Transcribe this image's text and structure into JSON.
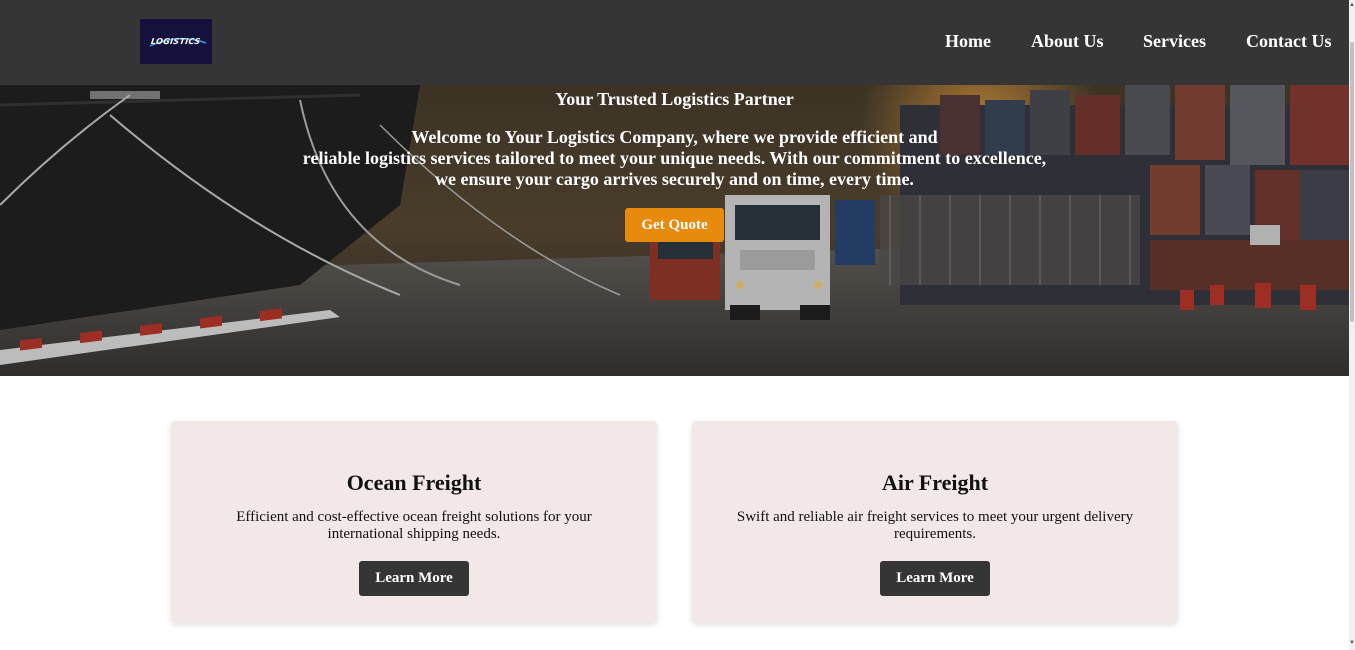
{
  "header": {
    "logo_text": "LOGISTICS",
    "nav": [
      {
        "label": "Home"
      },
      {
        "label": "About Us"
      },
      {
        "label": "Services"
      },
      {
        "label": "Contact Us"
      }
    ]
  },
  "hero": {
    "title": "Your Trusted Logistics Partner",
    "lines": [
      "Welcome to Your Logistics Company, where we provide efficient and",
      "reliable logistics services tailored to meet your unique needs. With our commitment to excellence,",
      "we ensure your cargo arrives securely and on time, every time."
    ],
    "cta_label": "Get Quote"
  },
  "services": [
    {
      "title": "Ocean Freight",
      "description": "Efficient and cost-effective ocean freight solutions for your international shipping needs.",
      "button_label": "Learn More"
    },
    {
      "title": "Air Freight",
      "description": "Swift and reliable air freight services to meet your urgent delivery requirements.",
      "button_label": "Learn More"
    }
  ],
  "colors": {
    "header_bg": "#353535",
    "accent": "#e88a0d",
    "card_bg": "#f2e8e8",
    "button_dark": "#353535"
  }
}
